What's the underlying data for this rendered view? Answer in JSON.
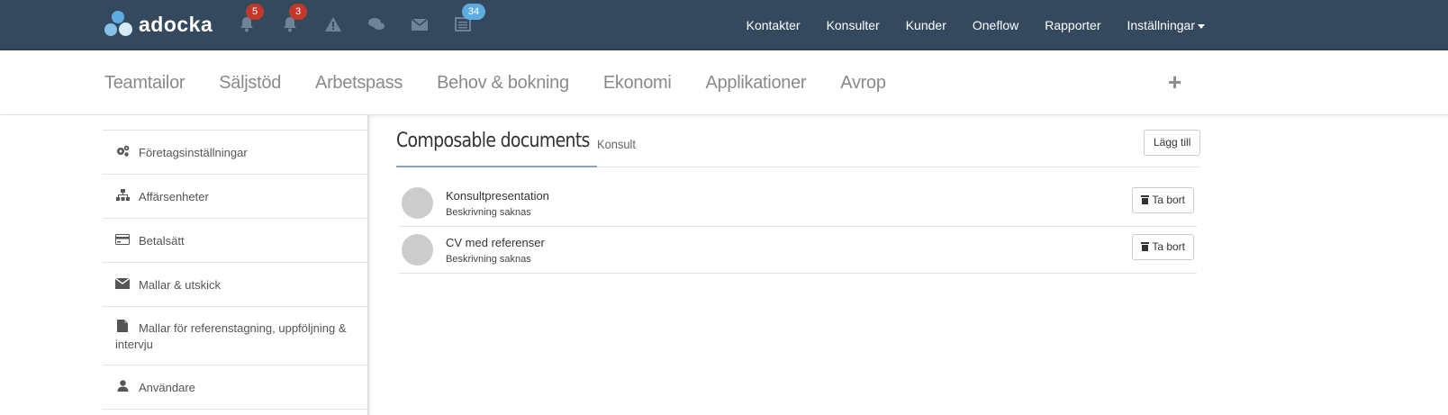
{
  "topbar": {
    "logo_text": "adocka",
    "icons": [
      {
        "name": "bell-icon",
        "badge": "5",
        "badge_color": "#c0392b"
      },
      {
        "name": "bell-icon",
        "badge": "3",
        "badge_color": "#c0392b"
      },
      {
        "name": "warning-icon",
        "badge": null
      },
      {
        "name": "chat-icon",
        "badge": null
      },
      {
        "name": "envelope-icon",
        "badge": null
      },
      {
        "name": "list-icon",
        "badge": "34",
        "badge_color": "#5dade2"
      }
    ],
    "links": [
      "Kontakter",
      "Konsulter",
      "Kunder",
      "Oneflow",
      "Rapporter",
      "Inställningar"
    ]
  },
  "subnav": {
    "items": [
      "Teamtailor",
      "Säljstöd",
      "Arbetspass",
      "Behov & bokning",
      "Ekonomi",
      "Applikationer",
      "Avrop"
    ],
    "plus": "+"
  },
  "sidebar": {
    "items": [
      {
        "label": "Företagsinställningar",
        "icon": "gears-icon"
      },
      {
        "label": "Affärsenheter",
        "icon": "sitemap-icon"
      },
      {
        "label": "Betalsätt",
        "icon": "credit-card-icon"
      },
      {
        "label": "Mallar & utskick",
        "icon": "envelope-icon"
      },
      {
        "label": "Mallar för referenstagning, uppföljning & intervju",
        "icon": "file-icon"
      },
      {
        "label": "Användare",
        "icon": "user-icon"
      }
    ]
  },
  "main": {
    "title": "Composable documents",
    "subtitle": "Konsult",
    "add_label": "Lägg till",
    "documents": [
      {
        "name": "Konsultpresentation",
        "description": "Beskrivning saknas",
        "delete_label": "Ta bort"
      },
      {
        "name": "CV med referenser",
        "description": "Beskrivning saknas",
        "delete_label": "Ta bort"
      }
    ]
  },
  "colors": {
    "topbar_bg": "#34495e",
    "badge_red": "#c0392b",
    "badge_blue": "#5dade2"
  }
}
